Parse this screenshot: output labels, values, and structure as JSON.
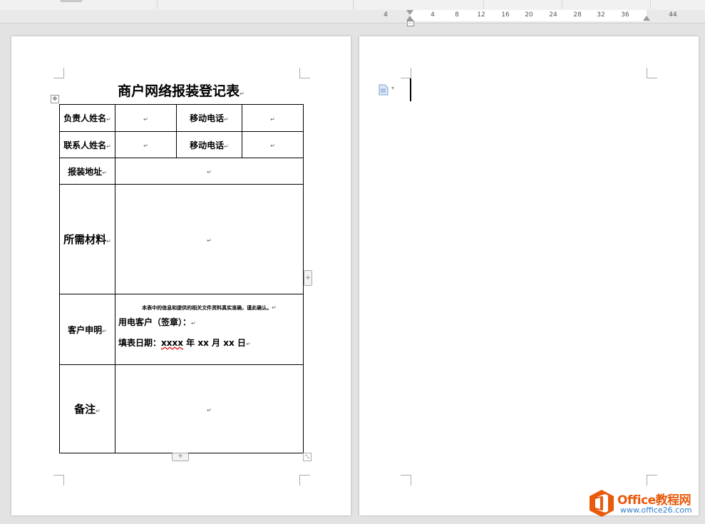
{
  "ruler": {
    "ticks": [
      "4",
      "4",
      "8",
      "12",
      "16",
      "20",
      "24",
      "28",
      "32",
      "36",
      "44"
    ]
  },
  "page1": {
    "title": "商户网络报装登记表",
    "paragraph_mark": "↵",
    "table": {
      "row1": {
        "name_label": "负责人姓名",
        "phone_label": "移动电话",
        "name_value": "",
        "phone_value": ""
      },
      "row2": {
        "name_label": "联系人姓名",
        "phone_label": "移动电话",
        "name_value": "",
        "phone_value": ""
      },
      "row3": {
        "address_label": "报装地址",
        "address_value": ""
      },
      "row4": {
        "materials_label": "所需材料",
        "materials_value": ""
      },
      "row5": {
        "declaration_label": "客户申明",
        "declaration_note": "本表中的信息和提供的相关文件资料真实准确，谨此确认。",
        "signature_label": "用电客户（签章）：",
        "date_prefix": "填表日期：",
        "date_year": "xxxx",
        "date_year_unit": "年",
        "date_month": "xx",
        "date_month_unit": "月",
        "date_day": "xx",
        "date_day_unit": "日"
      },
      "row6": {
        "remarks_label": "备注",
        "remarks_value": ""
      }
    }
  },
  "page2": {
    "icons": [
      "document-icon",
      "dropdown-arrow-icon"
    ]
  },
  "watermark": {
    "name": "Office教程网",
    "url": "www.office26.com"
  },
  "colors": {
    "logo_orange": "#e85a0c",
    "logo_blue": "#2f7fd0",
    "workspace": "#e3e3e3"
  }
}
